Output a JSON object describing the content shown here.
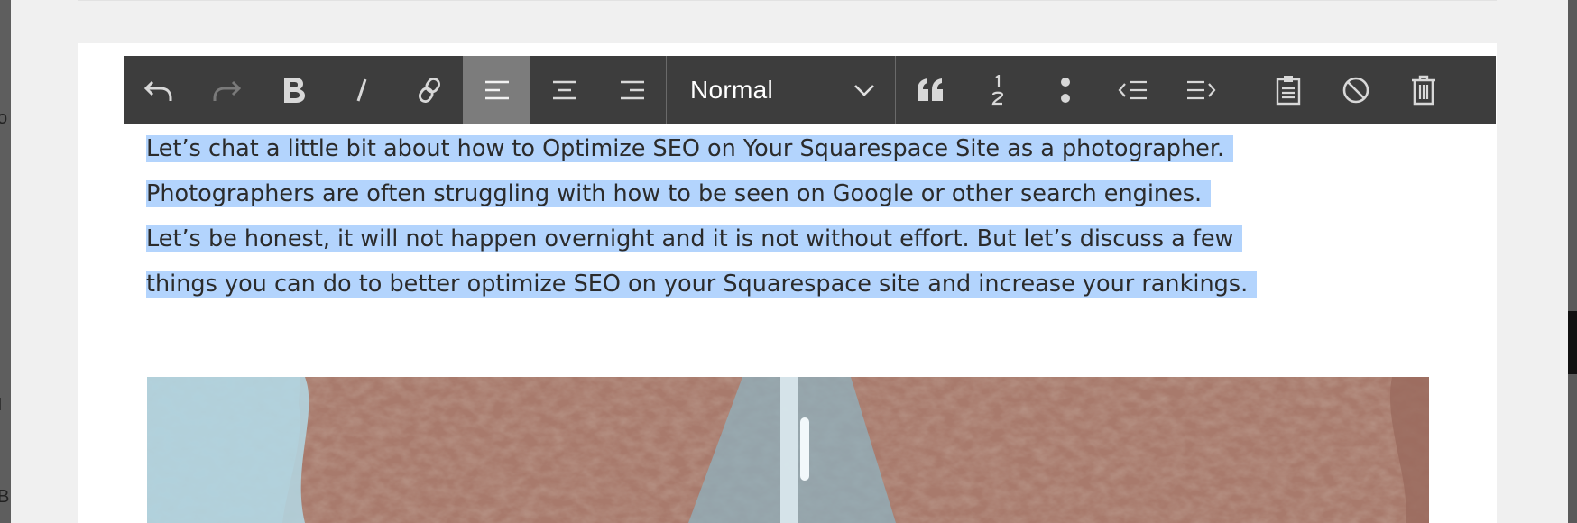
{
  "toolbar": {
    "buttons": [
      {
        "name": "undo",
        "state": "enabled"
      },
      {
        "name": "redo",
        "state": "disabled"
      },
      {
        "name": "bold"
      },
      {
        "name": "italic"
      },
      {
        "name": "link"
      },
      {
        "name": "align-left",
        "state": "active"
      },
      {
        "name": "align-center"
      },
      {
        "name": "align-right"
      },
      {
        "name": "blockquote"
      },
      {
        "name": "ordered-list"
      },
      {
        "name": "bullet-list"
      },
      {
        "name": "outdent"
      },
      {
        "name": "indent"
      },
      {
        "name": "paste-as-text"
      },
      {
        "name": "clear-formatting"
      },
      {
        "name": "delete-block"
      }
    ],
    "format_select": {
      "value": "Normal"
    }
  },
  "content": {
    "paragraph_lines": [
      "Let’s chat a little bit about how to Optimize SEO on Your Squarespace Site as a photographer.",
      "Photographers are often struggling with how to be seen on Google or other search engines.",
      "Let’s be honest, it will not happen overnight and it is not without effort. But let’s discuss a few",
      "things you can do to better optimize SEO on your Squarespace site and increase your rankings."
    ],
    "selection": "all"
  },
  "colors": {
    "toolbar_bg": "#3d3d3d",
    "toolbar_active": "#7c7c7c",
    "selection": "#b3d4fd",
    "text": "#2b2b2b"
  },
  "gutter": {
    "glyphs": [
      "o",
      "I",
      "B"
    ]
  }
}
